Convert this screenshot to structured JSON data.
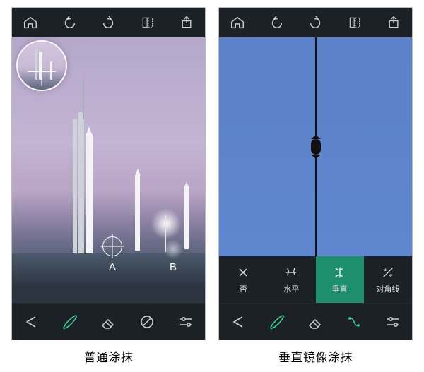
{
  "colors": {
    "bg": "#1b2126",
    "accent": "#3fd79b",
    "selected_bg": "#1e8f6d"
  },
  "topbar": {
    "home_icon": "home-icon",
    "undo_icon": "undo-icon",
    "redo_icon": "redo-icon",
    "compare_icon": "compare-icon",
    "share_icon": "share-icon"
  },
  "left": {
    "caption": "普通涂抹",
    "labels": {
      "a": "A",
      "b": "B"
    },
    "toolrow": {
      "back_icon": "back-arrow-icon",
      "brush_icon": "brush-icon",
      "eraser_icon": "eraser-icon",
      "mirror_icon": "mirror-crossed-icon",
      "sliders_icon": "sliders-icon"
    }
  },
  "right": {
    "caption": "垂直镜像涂抹",
    "mirror_options": [
      {
        "key": "none",
        "label": "否"
      },
      {
        "key": "horiz",
        "label": "水平"
      },
      {
        "key": "vert",
        "label": "垂直"
      },
      {
        "key": "diagonal",
        "label": "对角线"
      }
    ],
    "selected_mirror": "vert",
    "toolrow": {
      "back_icon": "back-arrow-icon",
      "brush_icon": "brush-icon",
      "eraser_icon": "eraser-icon",
      "mirror_icon": "mirror-icon",
      "sliders_icon": "sliders-icon"
    }
  }
}
